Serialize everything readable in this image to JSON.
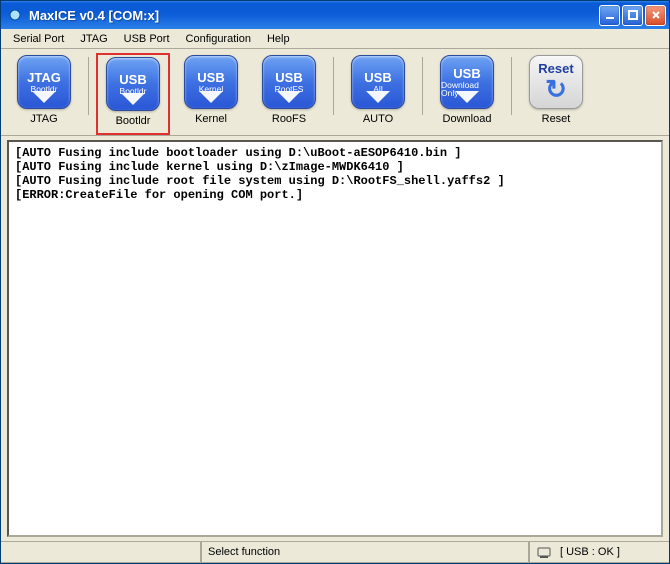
{
  "titlebar": {
    "title": "MaxICE v0.4    [COM:x]"
  },
  "menu": {
    "items": [
      "Serial Port",
      "JTAG",
      "USB Port",
      "Configuration",
      "Help"
    ]
  },
  "toolbar": {
    "buttons": [
      {
        "top": "JTAG",
        "sub": "Bootldr",
        "caption": "JTAG",
        "chevron": true,
        "reset": false,
        "group": 1
      },
      {
        "top": "USB",
        "sub": "Bootldr",
        "caption": "Bootldr",
        "chevron": true,
        "reset": false,
        "group": 2,
        "highlight": true
      },
      {
        "top": "USB",
        "sub": "Kernel",
        "caption": "Kernel",
        "chevron": true,
        "reset": false,
        "group": 2
      },
      {
        "top": "USB",
        "sub": "RootFS",
        "caption": "RooFS",
        "chevron": true,
        "reset": false,
        "group": 2
      },
      {
        "top": "USB",
        "sub": "All",
        "caption": "AUTO",
        "chevron": true,
        "reset": false,
        "group": 3
      },
      {
        "top": "USB",
        "sub": "Download Only",
        "caption": "Download",
        "chevron": true,
        "reset": false,
        "group": 4
      },
      {
        "top": "Reset",
        "sub": "",
        "caption": "Reset",
        "chevron": false,
        "reset": true,
        "group": 5
      }
    ]
  },
  "console": {
    "lines": [
      "[AUTO Fusing include bootloader using D:\\uBoot-aESOP6410.bin ]",
      "[AUTO Fusing include kernel using D:\\zImage-MWDK6410 ]",
      "[AUTO Fusing include root file system using D:\\RootFS_shell.yaffs2 ]",
      "[ERROR:CreateFile for opening COM port.]"
    ]
  },
  "status": {
    "panel1": "",
    "panel2": "Select function",
    "panel3": "[ USB : OK ]"
  }
}
